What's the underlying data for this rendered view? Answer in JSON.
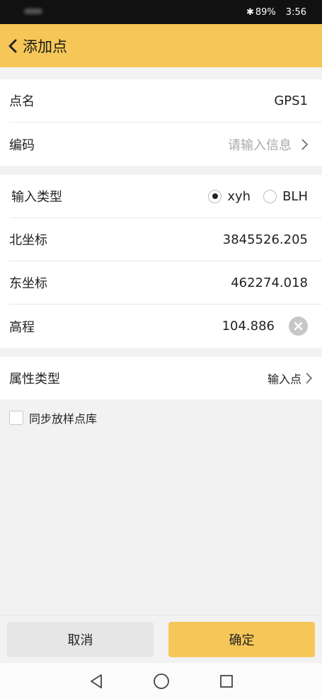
{
  "status": {
    "battery": "89%",
    "time": "3:56"
  },
  "header": {
    "title": "添加点"
  },
  "point": {
    "name_label": "点名",
    "name_value": "GPS1",
    "code_label": "编码",
    "code_placeholder": "请输入信息"
  },
  "coords": {
    "input_type_label": "输入类型",
    "option_xyh": "xyh",
    "option_blh": "BLH",
    "selected": "xyh",
    "north_label": "北坐标",
    "north_value": "3845526.205",
    "east_label": "东坐标",
    "east_value": "462274.018",
    "height_label": "高程",
    "height_value": "104.886"
  },
  "attribute": {
    "label": "属性类型",
    "value": "输入点"
  },
  "sync": {
    "label": "同步放样点库",
    "checked": false
  },
  "actions": {
    "cancel": "取消",
    "confirm": "确定"
  },
  "icons": [
    "back-chevron-icon",
    "bluetooth-icon",
    "chevron-right-icon",
    "clear-icon",
    "nav-back-icon",
    "nav-home-icon",
    "nav-recents-icon"
  ],
  "colors": {
    "accent": "#f6c758",
    "status_bar": "#111111"
  }
}
